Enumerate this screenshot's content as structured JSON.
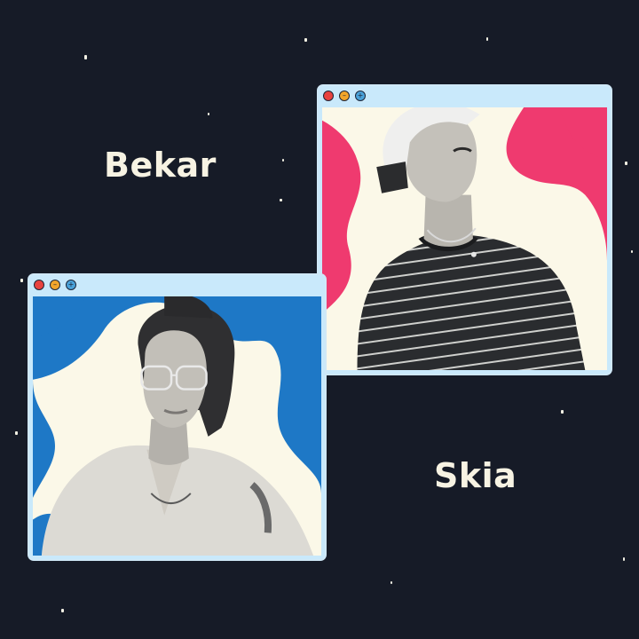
{
  "profiles": [
    {
      "name": "Bekar",
      "window_buttons": [
        "close",
        "minimize",
        "maximize"
      ],
      "accent_color": "#ef3a6f",
      "photo": "man-portrait"
    },
    {
      "name": "Skia",
      "window_buttons": [
        "close",
        "minimize",
        "maximize"
      ],
      "accent_color": "#1e78c6",
      "photo": "woman-portrait"
    }
  ],
  "colors": {
    "background": "#161b27",
    "window_frame": "#c9e9fb",
    "text": "#f7f3e3",
    "close": "#e8423f",
    "minimize": "#f2a52b",
    "maximize": "#4aa2d9"
  }
}
